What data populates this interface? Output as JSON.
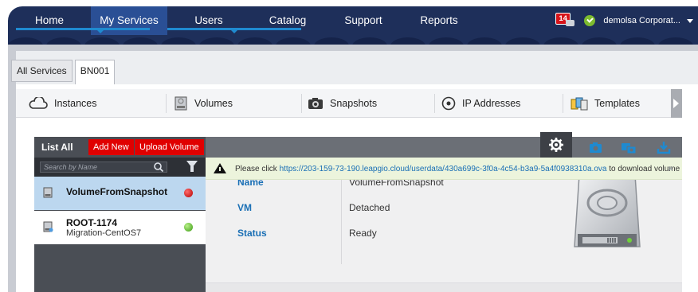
{
  "nav": {
    "items": [
      "Home",
      "My Services",
      "Users",
      "Catalog",
      "Support",
      "Reports"
    ],
    "active": "My Services",
    "notifications": "14",
    "account": "demolsa Corporat..."
  },
  "tabs": [
    "All Services",
    "BN001"
  ],
  "categories": [
    "Instances",
    "Volumes",
    "Snapshots",
    "IP Addresses",
    "Templates"
  ],
  "list": {
    "header": "List All",
    "add_new": "Add New",
    "upload": "Upload Volume",
    "search_placeholder": "Search by Name",
    "items": [
      {
        "name": "VolumeFromSnapshot",
        "sub": "",
        "status_color": "#d00000"
      },
      {
        "name": "ROOT-1174",
        "sub": "Migration-CentOS7",
        "status_color": "#3a9a12"
      }
    ]
  },
  "notice": {
    "before": "Please click ",
    "link": "https://203-159-73-190.leapgio.cloud/userdata/430a699c-3f0a-4c54-b3a9-5a4f0938310a.ova",
    "after": " to download volume",
    "close": "×"
  },
  "details": {
    "fields": [
      {
        "label": "Name",
        "value": "VolumeFromSnapshot"
      },
      {
        "label": "VM",
        "value": "Detached"
      },
      {
        "label": "Status",
        "value": "Ready"
      }
    ]
  },
  "toolbar_icons": [
    "gear-icon",
    "camera-icon",
    "camera-swap-icon",
    "download-icon"
  ]
}
